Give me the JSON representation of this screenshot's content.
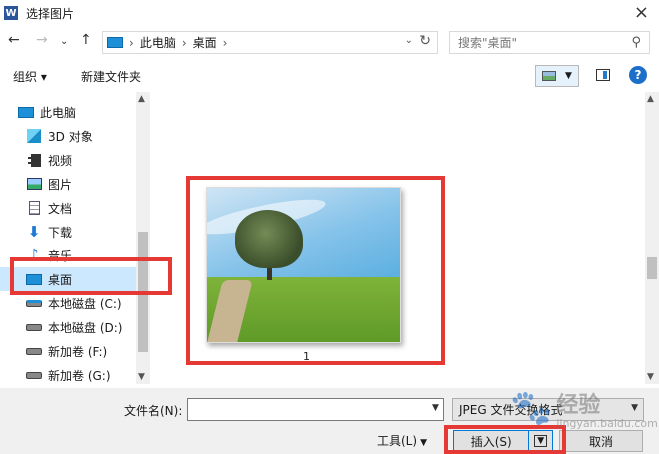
{
  "window": {
    "title": "选择图片",
    "app_icon": "W"
  },
  "nav": {
    "breadcrumb": [
      "此电脑",
      "桌面"
    ],
    "search_placeholder": "搜索\"桌面\"",
    "glyphs": {
      "back": "←",
      "forward": "→",
      "recent": "⌄",
      "up": "↑",
      "dropdown": "⌄",
      "refresh": "↻",
      "search": "⚲",
      "sep": "›"
    }
  },
  "toolbar": {
    "organize": "组织 ▾",
    "new_folder": "新建文件夹",
    "help": "?"
  },
  "sidebar": {
    "items": [
      {
        "label": "此电脑",
        "icon": "pc-icon"
      },
      {
        "label": "3D 对象",
        "icon": "3d-objects-icon"
      },
      {
        "label": "视频",
        "icon": "video-icon"
      },
      {
        "label": "图片",
        "icon": "pictures-icon"
      },
      {
        "label": "文档",
        "icon": "documents-icon"
      },
      {
        "label": "下载",
        "icon": "download-icon"
      },
      {
        "label": "音乐",
        "icon": "music-icon"
      },
      {
        "label": "桌面",
        "icon": "desktop-icon",
        "selected": true
      },
      {
        "label": "本地磁盘 (C:)",
        "icon": "drive-icon"
      },
      {
        "label": "本地磁盘 (D:)",
        "icon": "drive-icon"
      },
      {
        "label": "新加卷 (F:)",
        "icon": "drive-icon"
      },
      {
        "label": "新加卷 (G:)",
        "icon": "drive-icon"
      }
    ]
  },
  "content": {
    "file_label": "1"
  },
  "footer": {
    "filename_label": "文件名(N):",
    "filename_value": "",
    "filetype": "JPEG 文件交换格式",
    "tools": "工具(L)",
    "insert": "插入(S)",
    "cancel": "取消"
  },
  "watermark": {
    "main": "经验",
    "sub": "jingyan.baidu.com"
  },
  "colors": {
    "highlight": "#e53935",
    "selection": "#cce8ff",
    "accent": "#0078d7"
  }
}
